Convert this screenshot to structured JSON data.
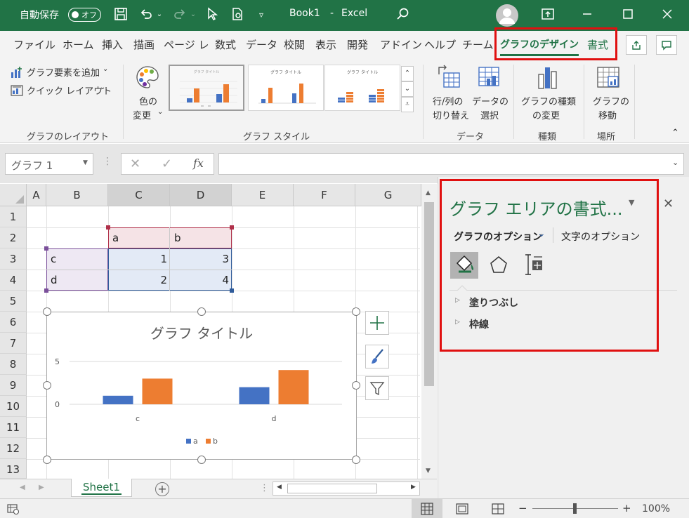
{
  "titlebar": {
    "autosave_label": "自動保存",
    "autosave_state": "オフ",
    "doc_title": "Book1",
    "separator": "-",
    "app_name": "Excel"
  },
  "tabs": [
    {
      "label": "ファイル"
    },
    {
      "label": "ホーム"
    },
    {
      "label": "挿入"
    },
    {
      "label": "描画"
    },
    {
      "label": "ページ レ"
    },
    {
      "label": "数式"
    },
    {
      "label": "データ"
    },
    {
      "label": "校閲"
    },
    {
      "label": "表示"
    },
    {
      "label": "開発"
    },
    {
      "label": "アドイン"
    },
    {
      "label": "ヘルプ"
    },
    {
      "label": "チーム"
    },
    {
      "label": "グラフのデザイン"
    },
    {
      "label": "書式"
    }
  ],
  "ribbon": {
    "layout_group": {
      "add_element": "グラフ要素を追加",
      "quick_layout": "クイック レイアウト",
      "label": "グラフのレイアウト"
    },
    "style_group": {
      "color_line1": "色の",
      "color_line2": "変更",
      "label": "グラフ スタイル",
      "thumb_title": "グラフ タイトル"
    },
    "data_group": {
      "switch_line1": "行/列の",
      "switch_line2": "切り替え",
      "select_line1": "データの",
      "select_line2": "選択",
      "label": "データ"
    },
    "type_group": {
      "change_line1": "グラフの種類",
      "change_line2": "の変更",
      "label": "種類"
    },
    "location_group": {
      "move_line1": "グラフの",
      "move_line2": "移動",
      "label": "場所"
    }
  },
  "formula_bar": {
    "name_box": "グラフ 1",
    "fx": "fx",
    "formula": ""
  },
  "sheet": {
    "columns": [
      "A",
      "B",
      "C",
      "D",
      "E",
      "F",
      "G"
    ],
    "rows": [
      "1",
      "2",
      "3",
      "4",
      "5",
      "6",
      "7",
      "8",
      "9",
      "10",
      "11",
      "12",
      "13"
    ],
    "cells": {
      "C2": "a",
      "D2": "b",
      "B3": "c",
      "C3": "1",
      "D3": "3",
      "B4": "d",
      "C4": "2",
      "D4": "4"
    },
    "tab_name": "Sheet1"
  },
  "chart_data": {
    "type": "bar",
    "title": "グラフ タイトル",
    "categories": [
      "c",
      "d"
    ],
    "series": [
      {
        "name": "a",
        "values": [
          1,
          2
        ],
        "color": "#4472c4"
      },
      {
        "name": "b",
        "values": [
          3,
          4
        ],
        "color": "#ed7d31"
      }
    ],
    "y_ticks": [
      "5",
      "0"
    ],
    "ylim": [
      0,
      5
    ],
    "grid": true,
    "legend": "bottom"
  },
  "task_pane": {
    "title": "グラフ エリアの書式...",
    "tab_chart_options": "グラフのオプション",
    "tab_text_options": "文字のオプション",
    "section_fill": "塗りつぶし",
    "section_border": "枠線"
  },
  "status_bar": {
    "zoom_minus": "−",
    "zoom_plus": "+",
    "zoom_level": "100%",
    "zoom_value": 1.0
  }
}
